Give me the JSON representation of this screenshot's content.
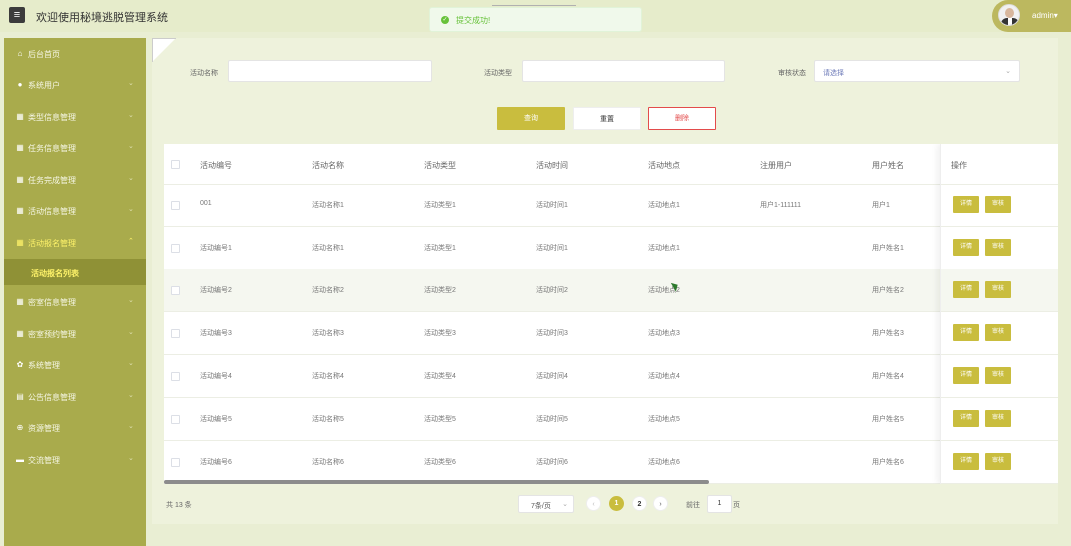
{
  "header": {
    "title": "欢迎使用秘境逃脱管理系统",
    "user": "admin",
    "user_caret": "▾",
    "toast": "提交成功!"
  },
  "sidebar": {
    "items": [
      {
        "label": "后台首页",
        "icon": "home-icon"
      },
      {
        "label": "系统用户",
        "icon": "user-icon"
      },
      {
        "label": "类型信息管理",
        "icon": "grid-icon"
      },
      {
        "label": "任务信息管理",
        "icon": "grid-icon"
      },
      {
        "label": "任务完成管理",
        "icon": "grid-icon"
      },
      {
        "label": "活动信息管理",
        "icon": "grid-icon"
      },
      {
        "label": "活动报名管理",
        "icon": "grid-icon",
        "active": true
      },
      {
        "label": "密室信息管理",
        "icon": "grid-icon"
      },
      {
        "label": "密室预约管理",
        "icon": "grid-icon"
      },
      {
        "label": "系统管理",
        "icon": "gear-icon"
      },
      {
        "label": "公告信息管理",
        "icon": "doc-icon"
      },
      {
        "label": "资源管理",
        "icon": "plus-circle-icon"
      },
      {
        "label": "交流管理",
        "icon": "chat-icon"
      }
    ],
    "sub_item": "活动报名列表"
  },
  "filters": {
    "name_label": "活动名称",
    "name_value": "",
    "type_label": "活动类型",
    "type_value": "",
    "status_label": "审核状态",
    "status_placeholder": "请选择"
  },
  "actions": {
    "query": "查询",
    "reset": "重置",
    "delete": "删除"
  },
  "table": {
    "headers": [
      "活动编号",
      "活动名称",
      "活动类型",
      "活动时间",
      "活动地点",
      "注册用户",
      "用户姓名",
      "操作"
    ],
    "rows": [
      [
        "001",
        "活动名称1",
        "活动类型1",
        "活动时间1",
        "活动地点1",
        "用户1-111111",
        "用户1"
      ],
      [
        "活动编号1",
        "活动名称1",
        "活动类型1",
        "活动时间1",
        "活动地点1",
        "",
        "用户姓名1"
      ],
      [
        "活动编号2",
        "活动名称2",
        "活动类型2",
        "活动时间2",
        "活动地点2",
        "",
        "用户姓名2"
      ],
      [
        "活动编号3",
        "活动名称3",
        "活动类型3",
        "活动时间3",
        "活动地点3",
        "",
        "用户姓名3"
      ],
      [
        "活动编号4",
        "活动名称4",
        "活动类型4",
        "活动时间4",
        "活动地点4",
        "",
        "用户姓名4"
      ],
      [
        "活动编号5",
        "活动名称5",
        "活动类型5",
        "活动时间5",
        "活动地点5",
        "",
        "用户姓名5"
      ],
      [
        "活动编号6",
        "活动名称6",
        "活动类型6",
        "活动时间6",
        "活动地点6",
        "",
        "用户姓名6"
      ]
    ],
    "op_detail": "详情",
    "op_review": "审核"
  },
  "pagination": {
    "total": "共 13 条",
    "page_size": "7条/页",
    "prev": "‹",
    "pages": [
      "1",
      "2"
    ],
    "next": "›",
    "goto_prefix": "前往",
    "goto_value": "1",
    "goto_suffix": "页"
  },
  "colors": {
    "accent": "#c9bd3e",
    "sidebar": "#a9ab4c",
    "danger": "#e34b4b"
  }
}
